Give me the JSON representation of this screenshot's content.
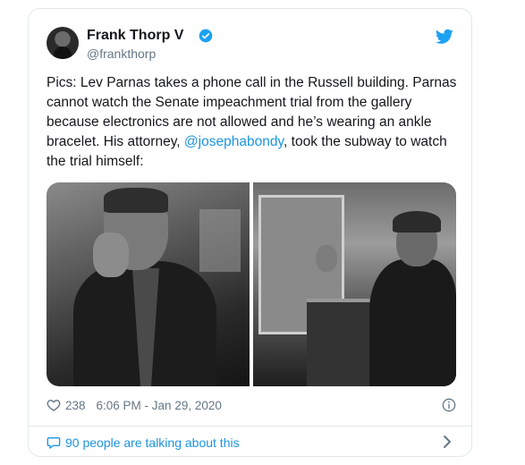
{
  "tweet": {
    "author_name": "Frank Thorp V",
    "author_handle": "@frankthorp",
    "text_before": "Pics: Lev Parnas takes a phone call in the Russell building. Parnas cannot watch the Senate impeachment trial from the gallery because electronics are not allowed and he’s wearing an ankle bracelet. His attorney, ",
    "mention": "@josephabondy",
    "text_after": ", took the subway to watch the trial himself:",
    "likes": "238",
    "timestamp": "6:06 PM - Jan 29, 2020",
    "talking": "90 people are talking about this"
  },
  "icons": {
    "verified": "verified-badge-icon",
    "twitter": "twitter-bird-icon",
    "like": "heart-icon",
    "info": "info-icon",
    "talk": "speech-bubble-icon",
    "chevron": "chevron-right-icon"
  },
  "colors": {
    "link": "#1b95e0",
    "secondary": "#657786",
    "verified": "#1da1f2",
    "border": "#e1e8ed"
  }
}
